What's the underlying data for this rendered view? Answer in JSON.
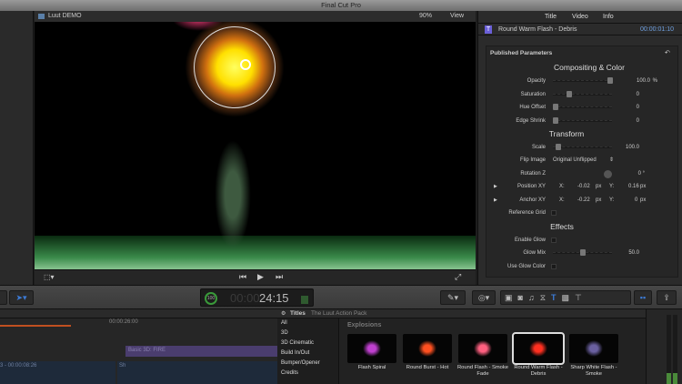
{
  "app": {
    "title": "Final Cut Pro"
  },
  "viewer": {
    "project": "Luut DEMO",
    "zoom": "90%",
    "view_label": "View"
  },
  "inspector": {
    "tabs": [
      "Title",
      "Video",
      "Info"
    ],
    "clip_name": "Round Warm Flash - Debris",
    "timecode": "00:00:01:10",
    "section_header": "Published Parameters",
    "compositing": {
      "title": "Compositing & Color",
      "opacity": {
        "label": "Opacity",
        "value": "100.0",
        "unit": "%",
        "fraction": 1.0
      },
      "saturation": {
        "label": "Saturation",
        "value": "0",
        "fraction": 0.25
      },
      "hue_offset": {
        "label": "Hue Offset",
        "value": "0",
        "fraction": 0.0
      },
      "edge_shrink": {
        "label": "Edge Shrink",
        "value": "0",
        "fraction": 0.0
      }
    },
    "transform": {
      "title": "Transform",
      "scale": {
        "label": "Scale",
        "value": "100.0",
        "fraction": 0.05
      },
      "flip_image": {
        "label": "Flip Image",
        "value": "Original Unflipped"
      },
      "rotation_z": {
        "label": "Rotation Z",
        "value": "0 °"
      },
      "position_xy": {
        "label": "Position XY",
        "x_label": "X:",
        "x": "-0.02",
        "x_unit": "px",
        "y_label": "Y:",
        "y": "0.16",
        "y_unit": "px"
      },
      "anchor_xy": {
        "label": "Anchor XY",
        "x_label": "X:",
        "x": "-0.22",
        "x_unit": "px",
        "y_label": "Y:",
        "y": "0",
        "y_unit": "px"
      },
      "reference_grid": {
        "label": "Reference Grid"
      }
    },
    "effects": {
      "title": "Effects",
      "enable_glow": {
        "label": "Enable Glow"
      },
      "glow_mix": {
        "label": "Glow Mix",
        "value": "50.0",
        "fraction": 0.5
      },
      "use_glow_color": {
        "label": "Use Glow Color"
      }
    }
  },
  "dashboard": {
    "percent": "100",
    "timecode_dim": "00:00",
    "timecode": "24:15"
  },
  "timeline": {
    "ruler_time": "00:00:26:00",
    "clip_title": "Basic 3D: FIRE",
    "clip_range": "3 - 00:00:08:26",
    "clip2": "Sh"
  },
  "browser": {
    "header": "Titles",
    "pack": "The Luut Action Pack",
    "categories": [
      "All",
      "3D",
      "3D Cinematic",
      "Build In/Out",
      "Bumper/Opener",
      "Credits"
    ],
    "group": "Explosions",
    "items": [
      {
        "name": "Flash Spiral",
        "color": "#c040d0"
      },
      {
        "name": "Round Burst - Hot",
        "color": "#ff5020"
      },
      {
        "name": "Round Flash - Smoke Fade",
        "color": "#ff6080"
      },
      {
        "name": "Round Warm Flash - Debris",
        "color": "#ff3020",
        "selected": true
      },
      {
        "name": "Sharp White Flash - Smoke",
        "color": "#6a60a0"
      }
    ]
  },
  "colors": {
    "accent": "#3c7bd6",
    "timecode": "#6fa0e0"
  }
}
